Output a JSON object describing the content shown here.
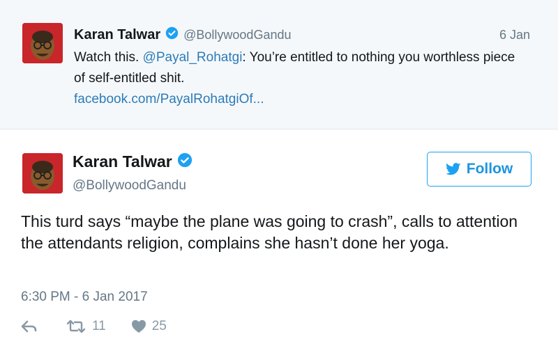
{
  "reply_tweet": {
    "name": "Karan Talwar",
    "handle": "@BollywoodGandu",
    "date": "6 Jan",
    "text_prefix": "Watch this. ",
    "mention": "@Payal_Rohatgi",
    "text_body": ": You’re entitled to nothing you worthless piece of self-entitled shit.",
    "link": "facebook.com/PayalRohatgiOf..."
  },
  "main_tweet": {
    "name": "Karan Talwar",
    "handle": "@BollywoodGandu",
    "follow_label": "Follow",
    "text": "This turd says “maybe the plane was going to crash”, calls to attention the attendants religion, complains she hasn’t done her yoga.",
    "timestamp": "6:30 PM - 6 Jan 2017",
    "retweets": "11",
    "likes": "25"
  },
  "icons": {
    "verified": "verified-badge-icon",
    "bird": "twitter-bird-icon",
    "reply": "reply-arrow-icon",
    "retweet": "retweet-icon",
    "like": "heart-icon"
  },
  "colors": {
    "accent": "#1da1f2",
    "link": "#2b7bb9",
    "muted": "#657786",
    "reply_background": "#f5f8fa",
    "avatar_background": "#c8262a"
  }
}
